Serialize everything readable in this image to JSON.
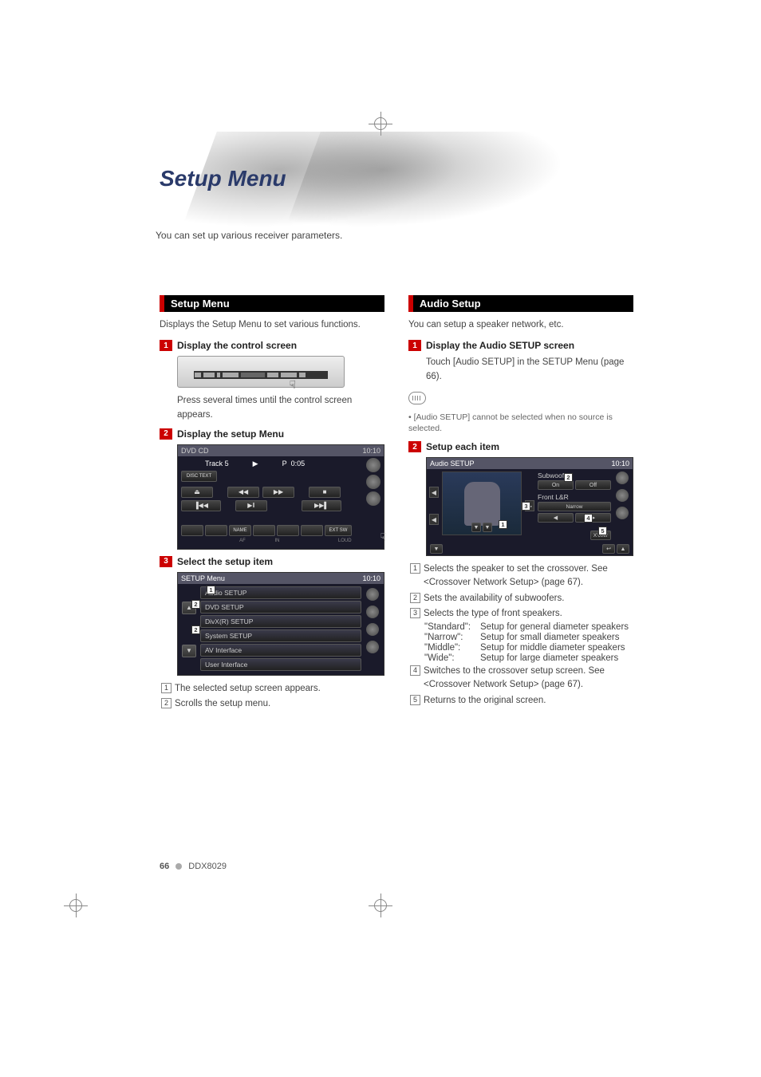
{
  "page": {
    "title": "Setup Menu",
    "subtitle": "You can set up various receiver parameters.",
    "page_number": "66",
    "model": "DDX8029"
  },
  "left": {
    "section_title": "Setup Menu",
    "intro": "Displays the Setup Menu to set various functions.",
    "steps": [
      {
        "num": "1",
        "title": "Display the control screen",
        "after_text": "Press several times until the control screen appears."
      },
      {
        "num": "2",
        "title": "Display the setup Menu"
      },
      {
        "num": "3",
        "title": "Select the setup item"
      }
    ],
    "dvd_screen": {
      "header_left": "DVD CD",
      "time": "10:10",
      "track_label": "Track 5",
      "play_icon": "▶",
      "p_label": "P",
      "timecode": "0:05",
      "disctext": "DISC TEXT",
      "btn_eject": "⏏",
      "btn_rw": "◀◀",
      "btn_ff": "▶▶",
      "btn_stop": "■",
      "btn_prev": "▐◀◀",
      "btn_pause": "▶‖",
      "btn_next": "▶▶▌",
      "bottom_name": "NAME",
      "bottom_extsw": "EXT SW",
      "bottom_af": "AF",
      "bottom_in": "IN",
      "bottom_loud": "LOUD"
    },
    "setup_menu_screen": {
      "header": "SETUP Menu",
      "time": "10:10",
      "items": [
        "Audio SETUP",
        "DVD SETUP",
        "DivX(R) SETUP",
        "System SETUP",
        "AV Interface",
        "User Interface"
      ]
    },
    "notes": [
      "The selected setup screen appears.",
      "Scrolls the setup menu."
    ]
  },
  "right": {
    "section_title": "Audio Setup",
    "intro": "You can setup a speaker network, etc.",
    "steps": [
      {
        "num": "1",
        "title": "Display the Audio SETUP screen",
        "after_text": "Touch [Audio SETUP] in the SETUP Menu (page 66)."
      },
      {
        "num": "2",
        "title": "Setup each item"
      }
    ],
    "note": "[Audio SETUP] cannot be selected when no source is selected.",
    "audio_screen": {
      "header": "Audio SETUP",
      "time": "10:10",
      "subwoofer_label": "Subwoofer",
      "sub_on": "On",
      "sub_off": "Off",
      "front_label": "Front L&R",
      "front_value": "Narrow",
      "xover": "X'over"
    },
    "list": [
      "Selects the speaker to set the crossover. See <Crossover Network Setup> (page 67).",
      "Sets the availability of subwoofers.",
      "Selects the type of front speakers.",
      "Switches to the crossover setup screen. See <Crossover Network Setup> (page 67).",
      "Returns to the original screen."
    ],
    "speaker_types": [
      {
        "key": "\"Standard\":",
        "val": "Setup for general diameter speakers"
      },
      {
        "key": "\"Narrow\":",
        "val": "Setup for small diameter speakers"
      },
      {
        "key": "\"Middle\":",
        "val": "Setup for middle diameter speakers"
      },
      {
        "key": "\"Wide\":",
        "val": "Setup for large diameter speakers"
      }
    ]
  }
}
